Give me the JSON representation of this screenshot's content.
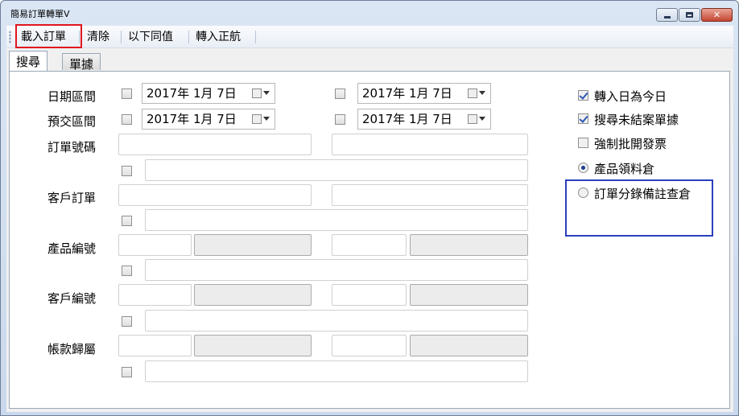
{
  "window": {
    "title": "簡易訂單轉單V"
  },
  "toolbar": {
    "load_order": "載入訂單",
    "clear": "清除",
    "same_as_above": "以下同值",
    "transfer": "轉入正航"
  },
  "tabs": {
    "search": "搜尋",
    "documents": "單據"
  },
  "form": {
    "date_range": {
      "label": "日期區間",
      "from": "2017年 1月 7日",
      "to": "2017年 1月 7日"
    },
    "delivery_range": {
      "label": "預交區間",
      "from": "2017年 1月 7日",
      "to": "2017年 1月 7日"
    },
    "order_no": {
      "label": "訂單號碼"
    },
    "customer_order": {
      "label": "客戶訂單"
    },
    "product_code": {
      "label": "產品編號"
    },
    "customer_code": {
      "label": "客戶編號"
    },
    "account": {
      "label": "帳款歸屬"
    }
  },
  "options": {
    "transfer_date_today": {
      "label": "轉入日為今日",
      "checked": true
    },
    "search_open_docs": {
      "label": "搜尋未結案單據",
      "checked": true
    },
    "force_invoice": {
      "label": "強制批開發票",
      "checked": false
    },
    "warehouse_product": {
      "label": "產品領料倉",
      "selected": true
    },
    "warehouse_order_note": {
      "label": "訂單分錄備註查倉",
      "selected": false
    }
  },
  "colors": {
    "highlight_red": "#e0161e",
    "highlight_blue": "#2b3fbd"
  }
}
